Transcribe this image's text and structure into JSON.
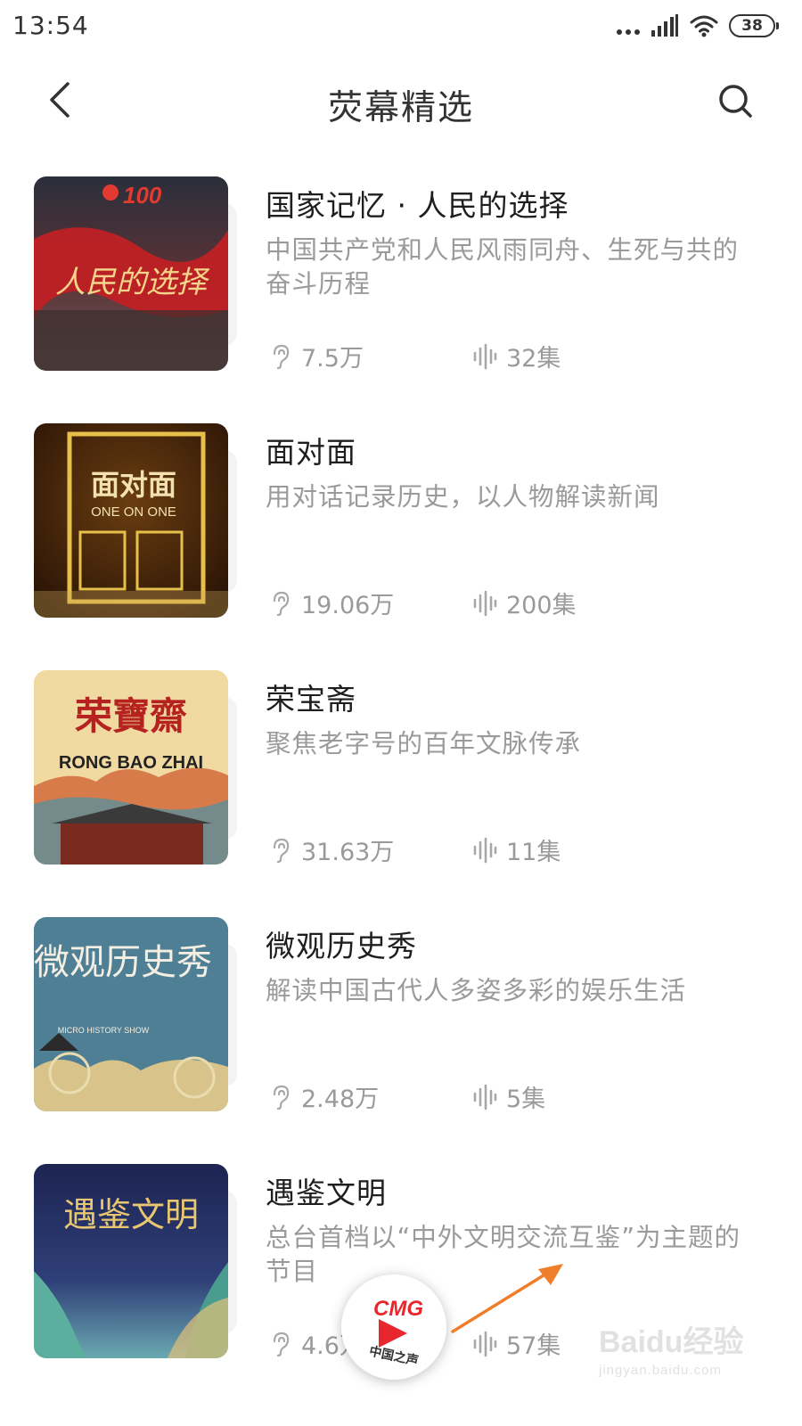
{
  "status_bar": {
    "time": "13:54",
    "battery": "38",
    "icons": [
      "more-dots-icon",
      "signal-icon",
      "wifi-icon",
      "battery-icon"
    ]
  },
  "header": {
    "title": "荧幕精选",
    "back_icon": "back-chevron-icon",
    "search_icon": "search-icon"
  },
  "programs": [
    {
      "title": "国家记忆 · 人民的选择",
      "description": "中国共产党和人民风雨同舟、生死与共的奋斗历程",
      "plays": "7.5万",
      "episodes": "32集",
      "cover_text": "人民的选择",
      "cover_badge": "100"
    },
    {
      "title": "面对面",
      "description": "用对话记录历史，以人物解读新闻",
      "plays": "19.06万",
      "episodes": "200集",
      "cover_text": "面对面",
      "cover_subtext": "ONE ON ONE"
    },
    {
      "title": "荣宝斋",
      "description": "聚焦老字号的百年文脉传承",
      "plays": "31.63万",
      "episodes": "11集",
      "cover_text": "荣寶齋",
      "cover_subtext": "RONG BAO ZHAI"
    },
    {
      "title": "微观历史秀",
      "description": "解读中国古代人多姿多彩的娱乐生活",
      "plays": "2.48万",
      "episodes": "5集",
      "cover_text": "微观历史秀",
      "cover_subtext": "MICRO HISTORY SHOW"
    },
    {
      "title": "遇鉴文明",
      "description": "总台首档以“中外文明交流互鉴”为主题的节目",
      "plays": "4.6万",
      "episodes": "57集",
      "cover_text": "遇鉴文明"
    }
  ],
  "player": {
    "logo_text": "CMG",
    "label": "中国之声",
    "icon": "play-icon"
  },
  "watermark": {
    "line1": "Baidu经验",
    "line2": "jingyan.baidu.com"
  },
  "colors": {
    "accent_red": "#e8262d",
    "arrow_orange": "#f07d2a",
    "meta_gray": "#9a9a9a"
  }
}
